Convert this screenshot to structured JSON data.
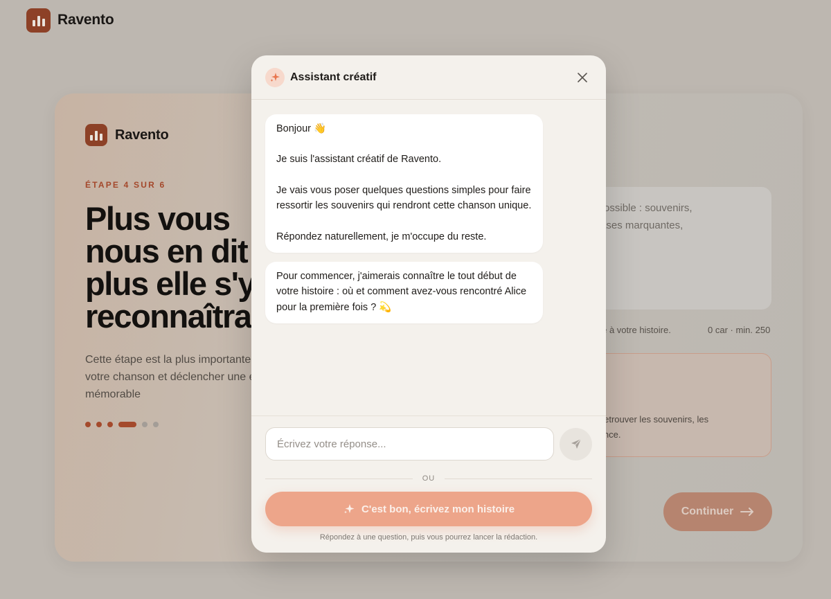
{
  "app": {
    "brand": "Ravento"
  },
  "background": {
    "step_label": "ÉTAPE 4 SUR 6",
    "headline": "Plus vous\nnous en dit\nplus elle s'y\nreconnaîtra",
    "subtext": "Cette étape est la plus importante\nvotre chanson et déclencher une é\nmémorable",
    "progress": {
      "total_steps": 6,
      "current_step": 4
    },
    "textarea_fragment": "ails possible : souvenirs,\n, phrases marquantes,",
    "hint_fragment": "èle à votre histoire.",
    "counter": "0 car · min. 250",
    "tip_fragment": "ide à retrouver les souvenirs, les\ndifférence.",
    "continue_label": "Continuer"
  },
  "modal": {
    "title": "Assistant créatif",
    "messages": [
      {
        "paragraphs": [
          "Bonjour 👋",
          "Je suis l'assistant créatif de Ravento.",
          "Je vais vous poser quelques questions simples pour faire ressortir les souvenirs qui rendront cette chanson unique.",
          "Répondez naturellement, je m'occupe du reste."
        ]
      },
      {
        "paragraphs": [
          "Pour commencer, j'aimerais connaître le tout début de votre histoire : où et comment avez-vous rencontré Alice pour la première fois ? 💫"
        ]
      }
    ],
    "input_placeholder": "Écrivez votre réponse...",
    "divider_label": "OU",
    "write_button_label": "C'est bon, écrivez mon histoire",
    "footnote": "Répondez à une question, puis vous pourrez lancer la rédaction."
  },
  "colors": {
    "brand": "#8d4127",
    "accent": "#eda58a",
    "step_label": "#a4482b"
  },
  "icons": {
    "logo": "bar-chart-icon",
    "assistant": "sparkle-icon",
    "close": "close-icon",
    "send": "paper-plane-icon",
    "continue": "arrow-right-icon"
  }
}
